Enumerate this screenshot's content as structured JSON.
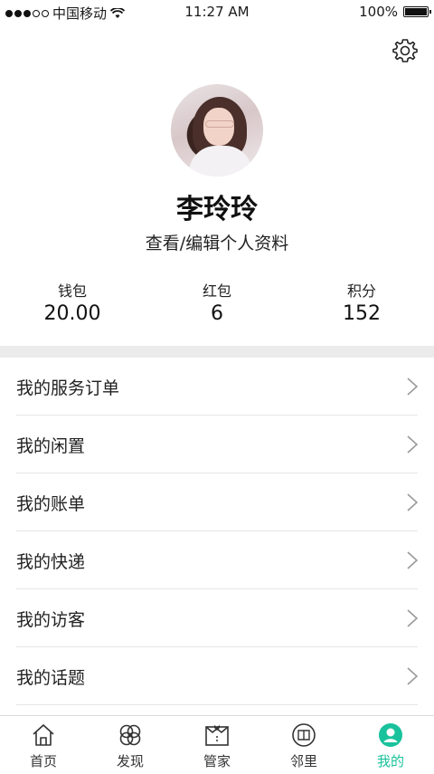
{
  "status_bar": {
    "carrier": "中国移动",
    "time": "11:27 AM",
    "battery": "100%"
  },
  "profile": {
    "name": "李玲玲",
    "edit_link": "查看/编辑个人资料"
  },
  "stats": [
    {
      "label": "钱包",
      "value": "20.00"
    },
    {
      "label": "红包",
      "value": "6"
    },
    {
      "label": "积分",
      "value": "152"
    }
  ],
  "menu": [
    {
      "label": "我的服务订单"
    },
    {
      "label": "我的闲置"
    },
    {
      "label": "我的账单"
    },
    {
      "label": "我的快递"
    },
    {
      "label": "我的访客"
    },
    {
      "label": "我的话题"
    }
  ],
  "tabs": [
    {
      "label": "首页",
      "icon": "home-icon"
    },
    {
      "label": "发现",
      "icon": "discover-icon"
    },
    {
      "label": "管家",
      "icon": "butler-icon"
    },
    {
      "label": "邻里",
      "icon": "neighbor-icon"
    },
    {
      "label": "我的",
      "icon": "profile-icon",
      "active": true
    }
  ],
  "colors": {
    "accent": "#19c29c",
    "divider": "#ebebeb"
  }
}
